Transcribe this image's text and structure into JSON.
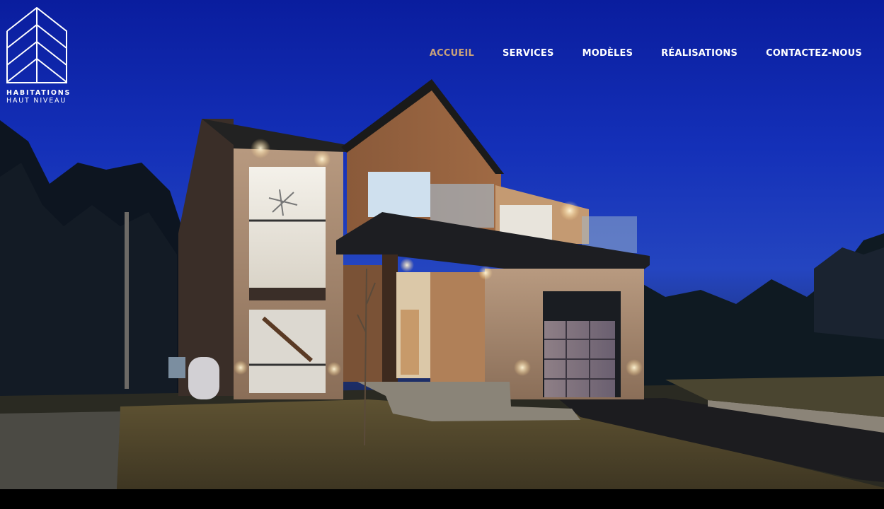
{
  "brand": {
    "line1": "HABITATIONS",
    "line2": "HAUT NIVEAU"
  },
  "nav": {
    "items": [
      {
        "label": "ACCUEIL",
        "active": true
      },
      {
        "label": "SERVICES",
        "active": false
      },
      {
        "label": "MODÈLES",
        "active": false
      },
      {
        "label": "RÉALISATIONS",
        "active": false
      },
      {
        "label": "CONTACTEZ-NOUS",
        "active": false
      }
    ]
  },
  "hero": {
    "image": "house-night-photo"
  },
  "colors": {
    "accent": "#c9a27a",
    "nav_text": "#ffffff",
    "sky": "#1430b8",
    "footer_bar": "#000000"
  }
}
